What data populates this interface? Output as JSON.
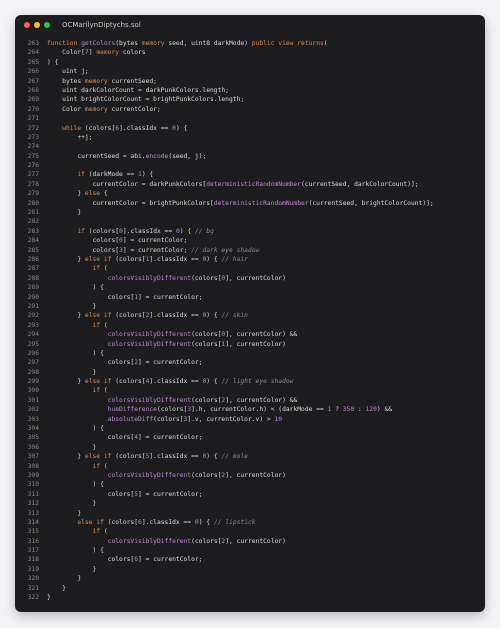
{
  "window": {
    "title": "OCMarilynDiptychs.sol",
    "colors": {
      "close": "#ff5f57",
      "minimize": "#febc2e",
      "zoom": "#28c840",
      "background": "#1d1d1f"
    }
  },
  "code": {
    "lines": [
      {
        "n": "263",
        "parts": [
          [
            "k",
            "function "
          ],
          [
            "f",
            "getColors"
          ],
          [
            "p",
            "(bytes "
          ],
          [
            "k",
            "memory"
          ],
          [
            "p",
            " seed, uint8 darkMode) "
          ],
          [
            "k",
            "public view returns"
          ],
          [
            "p",
            "("
          ]
        ]
      },
      {
        "n": "264",
        "parts": [
          [
            "p",
            "    Color["
          ],
          [
            "n",
            "7"
          ],
          [
            "p",
            "] "
          ],
          [
            "k",
            "memory"
          ],
          [
            "p",
            " colors"
          ]
        ]
      },
      {
        "n": "265",
        "parts": [
          [
            "p",
            ") {"
          ]
        ]
      },
      {
        "n": "266",
        "parts": [
          [
            "p",
            "    uint j;"
          ]
        ]
      },
      {
        "n": "267",
        "parts": [
          [
            "p",
            "    bytes "
          ],
          [
            "k",
            "memory"
          ],
          [
            "p",
            " currentSeed;"
          ]
        ]
      },
      {
        "n": "268",
        "parts": [
          [
            "p",
            "    uint darkColorCount = darkPunkColors.length;"
          ]
        ]
      },
      {
        "n": "269",
        "parts": [
          [
            "p",
            "    uint brightColorCount = brightPunkColors.length;"
          ]
        ]
      },
      {
        "n": "270",
        "parts": [
          [
            "p",
            "    Color "
          ],
          [
            "k",
            "memory"
          ],
          [
            "p",
            " currentColor;"
          ]
        ]
      },
      {
        "n": "271",
        "parts": [
          [
            "p",
            ""
          ]
        ]
      },
      {
        "n": "272",
        "parts": [
          [
            "p",
            "    "
          ],
          [
            "k",
            "while"
          ],
          [
            "p",
            " (colors["
          ],
          [
            "n",
            "6"
          ],
          [
            "p",
            "].classIdx == "
          ],
          [
            "n",
            "0"
          ],
          [
            "p",
            ") {"
          ]
        ]
      },
      {
        "n": "273",
        "parts": [
          [
            "p",
            "        ++j;"
          ]
        ]
      },
      {
        "n": "274",
        "parts": [
          [
            "p",
            ""
          ]
        ]
      },
      {
        "n": "275",
        "parts": [
          [
            "p",
            "        currentSeed = abi."
          ],
          [
            "f",
            "encode"
          ],
          [
            "p",
            "(seed, j);"
          ]
        ]
      },
      {
        "n": "276",
        "parts": [
          [
            "p",
            ""
          ]
        ]
      },
      {
        "n": "277",
        "parts": [
          [
            "p",
            "        "
          ],
          [
            "k",
            "if"
          ],
          [
            "p",
            " (darkMode == "
          ],
          [
            "n",
            "1"
          ],
          [
            "p",
            ") {"
          ]
        ]
      },
      {
        "n": "278",
        "parts": [
          [
            "p",
            "            currentColor = darkPunkColors["
          ],
          [
            "f",
            "deterministicRandomNumber"
          ],
          [
            "p",
            "(currentSeed, darkColorCount)];"
          ]
        ]
      },
      {
        "n": "279",
        "parts": [
          [
            "p",
            "        } "
          ],
          [
            "k",
            "else"
          ],
          [
            "p",
            " {"
          ]
        ]
      },
      {
        "n": "280",
        "parts": [
          [
            "p",
            "            currentColor = brightPunkColors["
          ],
          [
            "f",
            "deterministicRandomNumber"
          ],
          [
            "p",
            "(currentSeed, brightColorCount)];"
          ]
        ]
      },
      {
        "n": "281",
        "parts": [
          [
            "p",
            "        }"
          ]
        ]
      },
      {
        "n": "282",
        "parts": [
          [
            "p",
            ""
          ]
        ]
      },
      {
        "n": "283",
        "parts": [
          [
            "p",
            "        "
          ],
          [
            "k",
            "if"
          ],
          [
            "p",
            " (colors["
          ],
          [
            "n",
            "0"
          ],
          [
            "p",
            "].classIdx == "
          ],
          [
            "n",
            "0"
          ],
          [
            "p",
            ") { "
          ],
          [
            "c",
            "// bg"
          ]
        ]
      },
      {
        "n": "284",
        "parts": [
          [
            "p",
            "            colors["
          ],
          [
            "n",
            "0"
          ],
          [
            "p",
            "] = currentColor;"
          ]
        ]
      },
      {
        "n": "285",
        "parts": [
          [
            "p",
            "            colors["
          ],
          [
            "n",
            "3"
          ],
          [
            "p",
            "] = currentColor; "
          ],
          [
            "c",
            "// dark eye shadow"
          ]
        ]
      },
      {
        "n": "286",
        "parts": [
          [
            "p",
            "        } "
          ],
          [
            "k",
            "else if"
          ],
          [
            "p",
            " (colors["
          ],
          [
            "n",
            "1"
          ],
          [
            "p",
            "].classIdx == "
          ],
          [
            "n",
            "0"
          ],
          [
            "p",
            ") { "
          ],
          [
            "c",
            "// hair"
          ]
        ]
      },
      {
        "n": "287",
        "parts": [
          [
            "p",
            "            "
          ],
          [
            "k",
            "if"
          ],
          [
            "p",
            " ("
          ]
        ]
      },
      {
        "n": "288",
        "parts": [
          [
            "p",
            "                "
          ],
          [
            "f",
            "colorsVisiblyDifferent"
          ],
          [
            "p",
            "(colors["
          ],
          [
            "n",
            "0"
          ],
          [
            "p",
            "], currentColor)"
          ]
        ]
      },
      {
        "n": "289",
        "parts": [
          [
            "p",
            "            ) {"
          ]
        ]
      },
      {
        "n": "290",
        "parts": [
          [
            "p",
            "                colors["
          ],
          [
            "n",
            "1"
          ],
          [
            "p",
            "] = currentColor;"
          ]
        ]
      },
      {
        "n": "291",
        "parts": [
          [
            "p",
            "            }"
          ]
        ]
      },
      {
        "n": "292",
        "parts": [
          [
            "p",
            "        } "
          ],
          [
            "k",
            "else if"
          ],
          [
            "p",
            " (colors["
          ],
          [
            "n",
            "2"
          ],
          [
            "p",
            "].classIdx == "
          ],
          [
            "n",
            "0"
          ],
          [
            "p",
            ") { "
          ],
          [
            "c",
            "// skin"
          ]
        ]
      },
      {
        "n": "293",
        "parts": [
          [
            "p",
            "            "
          ],
          [
            "k",
            "if"
          ],
          [
            "p",
            " ("
          ]
        ]
      },
      {
        "n": "294",
        "parts": [
          [
            "p",
            "                "
          ],
          [
            "f",
            "colorsVisiblyDifferent"
          ],
          [
            "p",
            "(colors["
          ],
          [
            "n",
            "0"
          ],
          [
            "p",
            "], currentColor) &&"
          ]
        ]
      },
      {
        "n": "295",
        "parts": [
          [
            "p",
            "                "
          ],
          [
            "f",
            "colorsVisiblyDifferent"
          ],
          [
            "p",
            "(colors["
          ],
          [
            "n",
            "1"
          ],
          [
            "p",
            "], currentColor)"
          ]
        ]
      },
      {
        "n": "296",
        "parts": [
          [
            "p",
            "            ) {"
          ]
        ]
      },
      {
        "n": "297",
        "parts": [
          [
            "p",
            "                colors["
          ],
          [
            "n",
            "2"
          ],
          [
            "p",
            "] = currentColor;"
          ]
        ]
      },
      {
        "n": "298",
        "parts": [
          [
            "p",
            "            }"
          ]
        ]
      },
      {
        "n": "299",
        "parts": [
          [
            "p",
            "        } "
          ],
          [
            "k",
            "else if"
          ],
          [
            "p",
            " (colors["
          ],
          [
            "n",
            "4"
          ],
          [
            "p",
            "].classIdx == "
          ],
          [
            "n",
            "0"
          ],
          [
            "p",
            ") { "
          ],
          [
            "c",
            "// light eye shadow"
          ]
        ]
      },
      {
        "n": "300",
        "parts": [
          [
            "p",
            "            "
          ],
          [
            "k",
            "if"
          ],
          [
            "p",
            " ("
          ]
        ]
      },
      {
        "n": "301",
        "parts": [
          [
            "p",
            "                "
          ],
          [
            "f",
            "colorsVisiblyDifferent"
          ],
          [
            "p",
            "(colors["
          ],
          [
            "n",
            "2"
          ],
          [
            "p",
            "], currentColor) &&"
          ]
        ]
      },
      {
        "n": "302",
        "parts": [
          [
            "p",
            "                "
          ],
          [
            "f",
            "hueDifference"
          ],
          [
            "p",
            "(colors["
          ],
          [
            "n",
            "3"
          ],
          [
            "p",
            "].h, currentColor.h) < (darkMode == "
          ],
          [
            "n",
            "1"
          ],
          [
            "p",
            " ? "
          ],
          [
            "n",
            "350"
          ],
          [
            "p",
            " : "
          ],
          [
            "n",
            "120"
          ],
          [
            "p",
            ") &&"
          ]
        ]
      },
      {
        "n": "303",
        "parts": [
          [
            "p",
            "                "
          ],
          [
            "f",
            "absoluteDiff"
          ],
          [
            "p",
            "(colors["
          ],
          [
            "n",
            "3"
          ],
          [
            "p",
            "].v, currentColor.v) > "
          ],
          [
            "n",
            "10"
          ]
        ]
      },
      {
        "n": "304",
        "parts": [
          [
            "p",
            "            ) {"
          ]
        ]
      },
      {
        "n": "305",
        "parts": [
          [
            "p",
            "                colors["
          ],
          [
            "n",
            "4"
          ],
          [
            "p",
            "] = currentColor;"
          ]
        ]
      },
      {
        "n": "306",
        "parts": [
          [
            "p",
            "            }"
          ]
        ]
      },
      {
        "n": "307",
        "parts": [
          [
            "p",
            "        } "
          ],
          [
            "k",
            "else if"
          ],
          [
            "p",
            " (colors["
          ],
          [
            "n",
            "5"
          ],
          [
            "p",
            "].classIdx == "
          ],
          [
            "n",
            "0"
          ],
          [
            "p",
            ") { "
          ],
          [
            "c",
            "// mole"
          ]
        ]
      },
      {
        "n": "308",
        "parts": [
          [
            "p",
            "            "
          ],
          [
            "k",
            "if"
          ],
          [
            "p",
            " ("
          ]
        ]
      },
      {
        "n": "309",
        "parts": [
          [
            "p",
            "                "
          ],
          [
            "f",
            "colorsVisiblyDifferent"
          ],
          [
            "p",
            "(colors["
          ],
          [
            "n",
            "2"
          ],
          [
            "p",
            "], currentColor)"
          ]
        ]
      },
      {
        "n": "310",
        "parts": [
          [
            "p",
            "            ) {"
          ]
        ]
      },
      {
        "n": "311",
        "parts": [
          [
            "p",
            "                colors["
          ],
          [
            "n",
            "5"
          ],
          [
            "p",
            "] = currentColor;"
          ]
        ]
      },
      {
        "n": "312",
        "parts": [
          [
            "p",
            "            }"
          ]
        ]
      },
      {
        "n": "313",
        "parts": [
          [
            "p",
            "        }"
          ]
        ]
      },
      {
        "n": "314",
        "parts": [
          [
            "p",
            "        "
          ],
          [
            "k",
            "else if"
          ],
          [
            "p",
            " (colors["
          ],
          [
            "n",
            "6"
          ],
          [
            "p",
            "].classIdx == "
          ],
          [
            "n",
            "0"
          ],
          [
            "p",
            ") { "
          ],
          [
            "c",
            "// lipstick"
          ]
        ]
      },
      {
        "n": "315",
        "parts": [
          [
            "p",
            "            "
          ],
          [
            "k",
            "if"
          ],
          [
            "p",
            " ("
          ]
        ]
      },
      {
        "n": "316",
        "parts": [
          [
            "p",
            "                "
          ],
          [
            "f",
            "colorsVisiblyDifferent"
          ],
          [
            "p",
            "(colors["
          ],
          [
            "n",
            "2"
          ],
          [
            "p",
            "], currentColor)"
          ]
        ]
      },
      {
        "n": "317",
        "parts": [
          [
            "p",
            "            ) {"
          ]
        ]
      },
      {
        "n": "318",
        "parts": [
          [
            "p",
            "                colors["
          ],
          [
            "n",
            "6"
          ],
          [
            "p",
            "] = currentColor;"
          ]
        ]
      },
      {
        "n": "319",
        "parts": [
          [
            "p",
            "            }"
          ]
        ]
      },
      {
        "n": "320",
        "parts": [
          [
            "p",
            "        }"
          ]
        ]
      },
      {
        "n": "321",
        "parts": [
          [
            "p",
            "    }"
          ]
        ]
      },
      {
        "n": "322",
        "parts": [
          [
            "p",
            "}"
          ]
        ]
      }
    ]
  }
}
